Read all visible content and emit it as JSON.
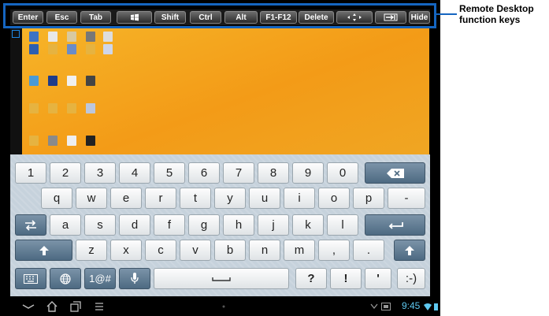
{
  "function_keys": [
    "Enter",
    "Esc",
    "Tab",
    "",
    "Shift",
    "Ctrl",
    "Alt",
    "F1-F12",
    "Delete",
    "",
    "",
    "Hide"
  ],
  "function_key_icons": [
    "",
    "",
    "",
    "windows-icon",
    "",
    "",
    "",
    "",
    "",
    "arrows-move-icon",
    "tab-arrow-icon",
    ""
  ],
  "callout": {
    "label_line1": "Remote Desktop",
    "label_line2": "function keys",
    "color": "#1565c0"
  },
  "desktop": {
    "icon_labels": [
      "",
      "",
      "",
      "",
      "",
      "",
      "",
      "",
      "",
      "",
      "",
      "",
      "",
      "",
      "",
      "",
      "",
      ""
    ]
  },
  "keyboard": {
    "row1": [
      "1",
      "2",
      "3",
      "4",
      "5",
      "6",
      "7",
      "8",
      "9",
      "0"
    ],
    "row2": [
      "q",
      "w",
      "e",
      "r",
      "t",
      "y",
      "u",
      "i",
      "o",
      "p",
      "-"
    ],
    "row3": [
      "a",
      "s",
      "d",
      "f",
      "g",
      "h",
      "j",
      "k",
      "l"
    ],
    "row4": [
      "z",
      "x",
      "c",
      "v",
      "b",
      "n",
      "m",
      ",",
      "."
    ],
    "row5": {
      "symbols": "1@#",
      "question": "?",
      "exclaim": "!",
      "apostrophe": "'",
      "smiley": ":-)"
    }
  },
  "status": {
    "time": "9:45"
  },
  "colors": {
    "desktop": "#f4a31f",
    "keyboard": "#c6d2dc",
    "accent": "#5ec8f0"
  }
}
